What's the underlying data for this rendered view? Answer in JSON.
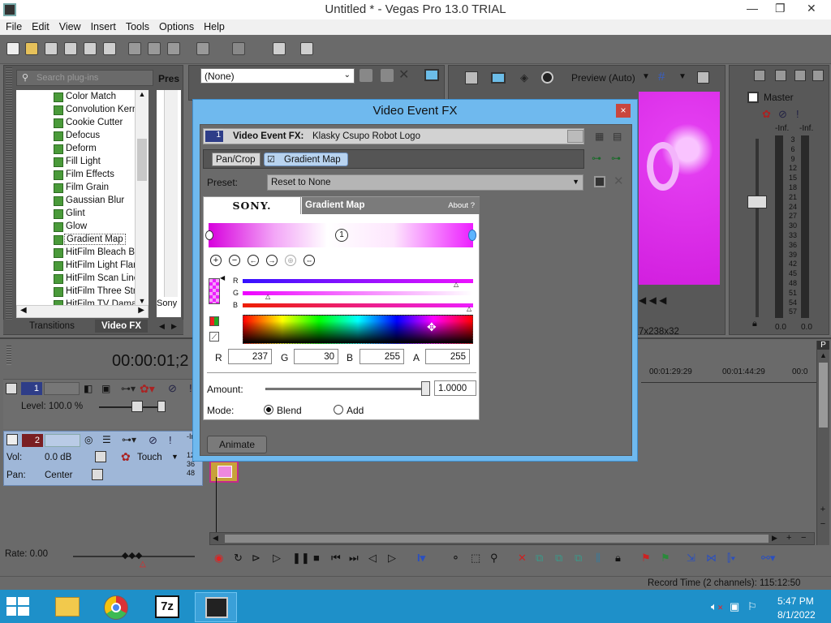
{
  "window": {
    "title": "Untitled * - Vegas Pro 13.0 TRIAL"
  },
  "menu": [
    "File",
    "Edit",
    "View",
    "Insert",
    "Tools",
    "Options",
    "Help"
  ],
  "plugins": {
    "search_placeholder": "Search plug-ins",
    "header": "Pres",
    "items": [
      "Color Match",
      "Convolution Kerne",
      "Cookie Cutter",
      "Defocus",
      "Deform",
      "Fill Light",
      "Film Effects",
      "Film Grain",
      "Gaussian Blur",
      "Glint",
      "Glow",
      "Gradient Map",
      "HitFilm Bleach Byp",
      "HitFilm Light Flares",
      "HitFilm Scan Lines",
      "HitFilm Three Strip",
      "HitFilm TV Damage"
    ],
    "selected": "Gradient Map",
    "side_label": "Sony",
    "tabs": [
      "Transitions",
      "Video FX"
    ]
  },
  "preview": {
    "dropdown": "(None)",
    "mode": "Preview (Auto)",
    "resolution": "7x238x32"
  },
  "master": {
    "label": "Master",
    "inf_left": "-Inf.",
    "inf_right": "-Inf.",
    "scale": [
      "3",
      "6",
      "9",
      "12",
      "15",
      "18",
      "21",
      "24",
      "27",
      "30",
      "33",
      "36",
      "39",
      "42",
      "45",
      "48",
      "51",
      "54",
      "57"
    ],
    "val_left": "0.0",
    "val_right": "0.0"
  },
  "timeline": {
    "time": "00:00:01;2",
    "marks": [
      "00:01:29:29",
      "00:01:44:29",
      "00:0"
    ],
    "track1": {
      "num": "1",
      "level_label": "Level: 100.0 %"
    },
    "track2": {
      "num": "2",
      "vol_label": "Vol:",
      "vol_value": "0.0 dB",
      "pan_label": "Pan:",
      "pan_value": "Center",
      "mode": "Touch",
      "side": [
        "-In",
        "12",
        "36",
        "48"
      ]
    },
    "rate": "Rate: 0.00",
    "record_time": "Record Time (2 channels): 115:12:50"
  },
  "dialog": {
    "title": "Video Event FX",
    "close": "×",
    "event_label": "Video Event FX:",
    "event_name": "Klasky Csupo Robot Logo",
    "chain": [
      "Pan/Crop",
      "Gradient Map"
    ],
    "preset_label": "Preset:",
    "preset_value": "Reset to None",
    "sony": "SONY.",
    "plugin_name": "Gradient Map",
    "about": "About  ?",
    "marker_num": "1",
    "channels": [
      "R",
      "G",
      "B"
    ],
    "rgba_labels": [
      "R",
      "G",
      "B",
      "A"
    ],
    "rgba_values": [
      "237",
      "30",
      "255",
      "255"
    ],
    "amount_label": "Amount:",
    "amount_value": "1.0000",
    "mode_label": "Mode:",
    "mode_options": [
      "Blend",
      "Add"
    ],
    "mode_selected": "Blend",
    "animate": "Animate"
  },
  "taskbar": {
    "time": "5:47 PM",
    "date": "8/1/2022"
  },
  "colors": {
    "accent": "#ed1eff",
    "dialog_frame": "#6fb9ee",
    "taskbar": "#1e90c9"
  }
}
